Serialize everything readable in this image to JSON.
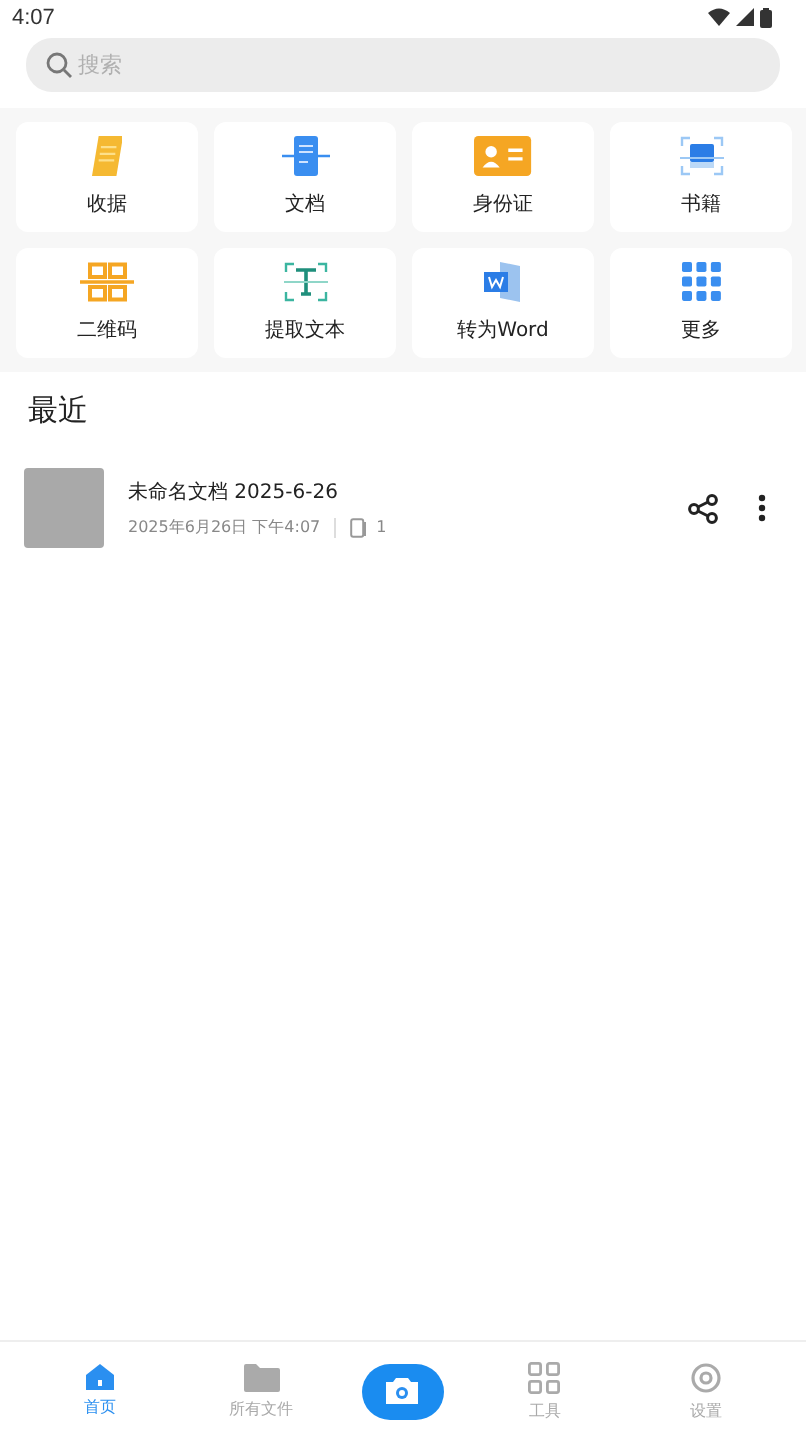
{
  "status_bar": {
    "time": "4:07"
  },
  "search": {
    "placeholder": "搜索"
  },
  "tools": [
    {
      "label": "收据",
      "kind": "receipt"
    },
    {
      "label": "文档",
      "kind": "document"
    },
    {
      "label": "身份证",
      "kind": "idcard"
    },
    {
      "label": "书籍",
      "kind": "book"
    },
    {
      "label": "二维码",
      "kind": "qrcode"
    },
    {
      "label": "提取文本",
      "kind": "text"
    },
    {
      "label": "转为Word",
      "kind": "word"
    },
    {
      "label": "更多",
      "kind": "more"
    }
  ],
  "recent": {
    "title": "最近",
    "items": [
      {
        "name": "未命名文档 2025-6-26",
        "date": "2025年6月26日 下午4:07",
        "pages": "1"
      }
    ]
  },
  "bottom_nav": [
    {
      "label": "首页",
      "kind": "home",
      "selected": true
    },
    {
      "label": "所有文件",
      "kind": "folder",
      "selected": false
    },
    {
      "kind": "camera"
    },
    {
      "label": "工具",
      "kind": "tools",
      "selected": false
    },
    {
      "label": "设置",
      "kind": "settings",
      "selected": false
    }
  ]
}
